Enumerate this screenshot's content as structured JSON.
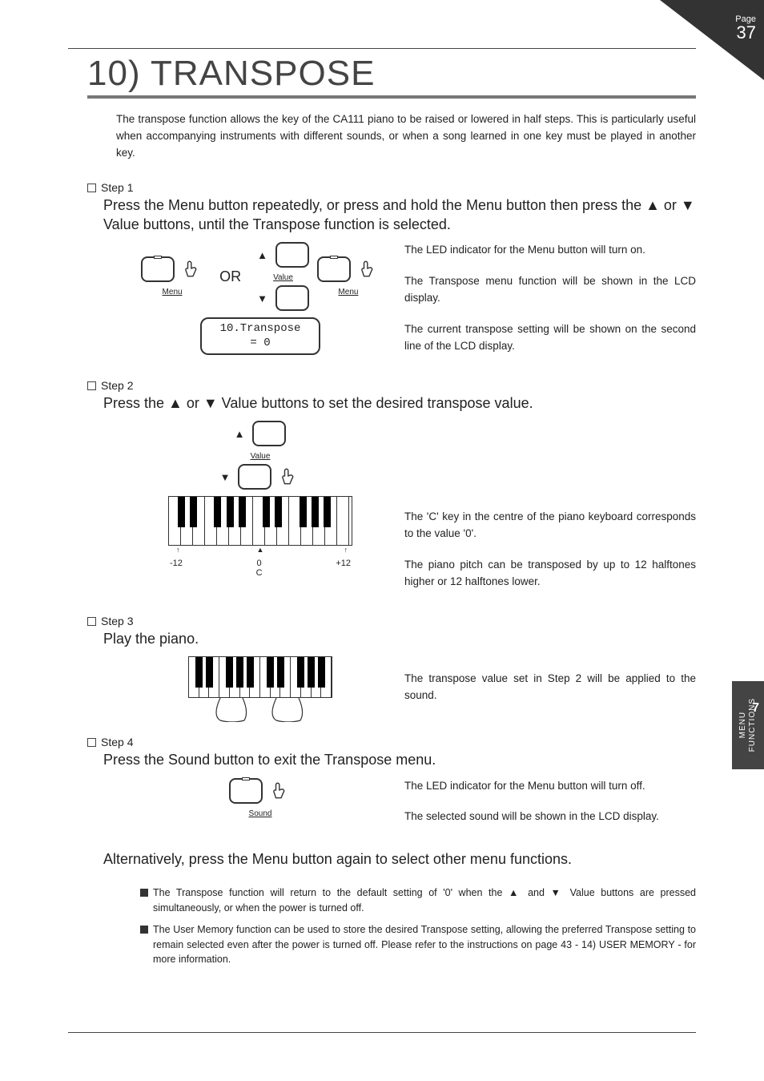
{
  "page": {
    "label": "Page",
    "number": "37"
  },
  "sideTab": {
    "line1": "MENU",
    "line2": "FUNCTIONS",
    "chapter": "7"
  },
  "title": "10) TRANSPOSE",
  "intro": "The transpose function allows the key of the CA111 piano to be raised or lowered in half steps. This is particularly useful when accompanying instruments with different sounds, or when a song learned in one key must be played in another key.",
  "steps": {
    "s1": {
      "head": "Step 1",
      "instr": "Press the Menu button repeatedly, or press and hold the Menu button then press the ▲ or ▼ Value buttons, until the Transpose function is selected.",
      "orLabel": "OR",
      "menuLabel": "Menu",
      "valueLabel": "Value",
      "lcdLine1": "10.Transpose",
      "lcdLine2": "=   0",
      "p1": "The LED indicator for the Menu button will turn on.",
      "p2": "The Transpose menu function will be shown in the LCD display.",
      "p3": "The current transpose setting will be shown on the second line of the LCD display."
    },
    "s2": {
      "head": "Step 2",
      "instr": "Press the ▲ or ▼ Value buttons to set the desired transpose value.",
      "valueLabel": "Value",
      "scaleLeft": "-12",
      "scaleMid": "0",
      "scaleMidSub": "C",
      "scaleRight": "+12",
      "p1": "The 'C' key in the centre of the piano keyboard corresponds to the value '0'.",
      "p2": "The piano pitch can be transposed by up to 12 halftones higher or 12 halftones lower."
    },
    "s3": {
      "head": "Step 3",
      "instr": "Play the piano.",
      "p1": "The transpose value set in Step 2 will be applied to the sound."
    },
    "s4": {
      "head": "Step 4",
      "instr": "Press the Sound button to exit the Transpose menu.",
      "soundLabel": "Sound",
      "p1": "The LED indicator for the Menu button will turn off.",
      "p2": "The selected sound will be shown in the LCD display."
    }
  },
  "altLine": "Alternatively, press the Menu button again to select other menu functions.",
  "notes": {
    "n1": "The Transpose function will return to the default setting of '0' when the ▲ and ▼ Value buttons are pressed simultaneously, or when the power is turned off.",
    "n2": "The User Memory function can be used to store the desired Transpose setting, allowing the preferred Transpose setting to remain selected even after the power is turned off.  Please refer to the instructions on page 43 - 14) USER MEMORY - for more information."
  }
}
